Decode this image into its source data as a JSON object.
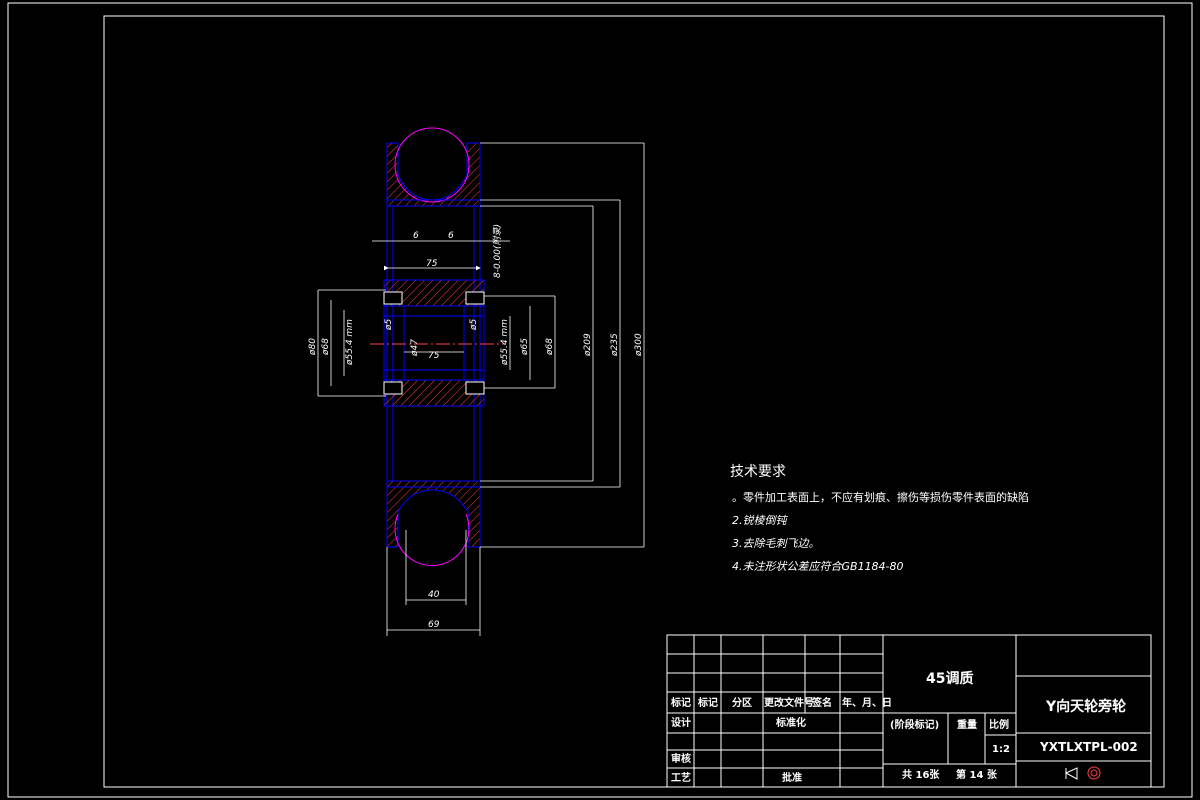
{
  "tech_requirements": {
    "title": "技术要求",
    "items": [
      "。零件加工表面上，不应有划痕、擦伤等损伤零件表面的缺陷",
      "2.锐棱倒钝",
      "3.去除毛刺飞边。",
      "4.未注形状公差应符合GB1184-80"
    ]
  },
  "dimensions": {
    "top_a": "6",
    "top_b": "6",
    "hub_width": "75",
    "inner_width": "75",
    "groove_note": "8-0.00(附录)",
    "phi80": "ø80",
    "phi68": "ø68",
    "phi55_left": "ø55.4 mm",
    "phi47": "ø47",
    "phi55_mid": "ø55.4 mm",
    "phi65": "ø65",
    "phi68_right": "ø68",
    "phi5": "ø5",
    "phi20": "ø5",
    "phi209": "ø209",
    "phi235": "ø235",
    "phi300": "ø300",
    "bottom_40": "40",
    "bottom_69": "69"
  },
  "title_block": {
    "material": "45调质",
    "part_name": "Y向天轮旁轮",
    "drawing_no": "YXTLXTPL-002",
    "headers": [
      "标记",
      "标记",
      "分区",
      "更改文件号",
      "签名",
      "年、月、日"
    ],
    "design": "设计",
    "standardize": "标准化",
    "review": "审核",
    "process": "工艺",
    "approve": "批准",
    "stage_mark": "(阶段标记)",
    "weight": "重量",
    "scale_label": "比例",
    "scale_value": "1:2",
    "sheets_total": "共 16张",
    "sheet_current": "第 14 张"
  },
  "colors": {
    "outline": "#0000ff",
    "hatch": "#ff4040",
    "circle": "#ff00ff",
    "dim": "#ffffff",
    "frame": "#ffffff"
  }
}
